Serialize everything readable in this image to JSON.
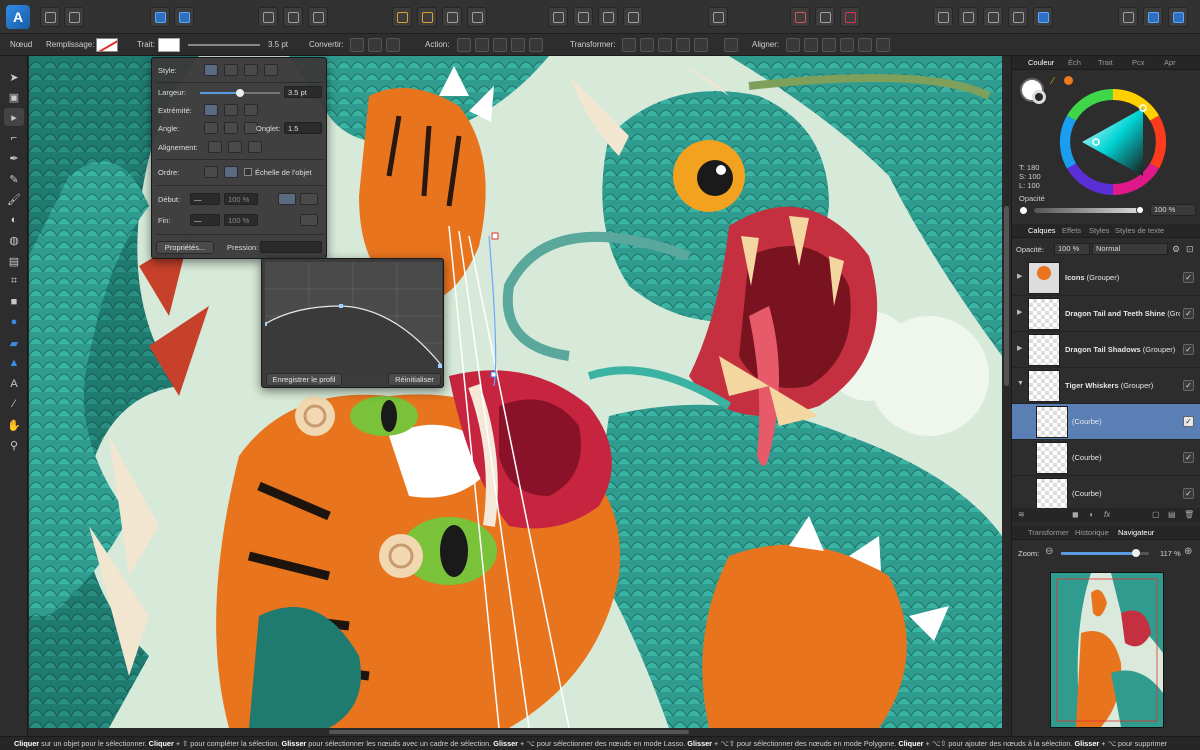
{
  "context_bar": {
    "mode": "Nœud",
    "fill_label": "Remplissage:",
    "stroke_label": "Trait:",
    "stroke_width": "3.5 pt",
    "convert_label": "Convertir:",
    "action_label": "Action:",
    "transform_label": "Transformer:",
    "align_label": "Aligner:"
  },
  "stroke_popover": {
    "style_label": "Style:",
    "width_label": "Largeur:",
    "width_value": "3.5 pt",
    "width_fraction": 0.5,
    "cap_label": "Extrémité:",
    "join_label": "Angle:",
    "miter_label": "Onglet:",
    "miter_value": "1.5",
    "align_label": "Alignement:",
    "order_label": "Ordre:",
    "scale_label": "Échelle de l'objet",
    "start_label": "Début:",
    "end_label": "Fin:",
    "start_pct": "100 %",
    "start_pct2": "100 %",
    "end_pct": "100 %",
    "end_pct2": "100 %",
    "properties_button": "Propriétés...",
    "pressure_label": "Pression:"
  },
  "pressure_popover": {
    "save_profile": "Enregistrer le profil",
    "reset": "Réinitialiser"
  },
  "color_panel": {
    "tabs": [
      "Couleur",
      "Éch",
      "Trait",
      "Pcx",
      "Apr"
    ],
    "active_tab": "Couleur",
    "t_value": "T: 180",
    "s_value": "S: 100",
    "l_value": "L: 100",
    "opacity_label": "Opacité",
    "opacity_value": "100 %"
  },
  "layers_panel": {
    "tabs": [
      "Calques",
      "Effets",
      "Styles",
      "Styles de texte"
    ],
    "active_tab": "Calques",
    "opacity_label": "Opacité:",
    "opacity_value": "100 %",
    "blend_mode": "Normal",
    "layers": [
      {
        "name": "Icons",
        "suffix": " (Grouper)"
      },
      {
        "name": "Dragon Tail and Teeth Shine",
        "suffix": " (Grouper)"
      },
      {
        "name": "Dragon Tail Shadows",
        "suffix": " (Grouper)"
      },
      {
        "name": "Tiger Whiskers",
        "suffix": " (Grouper)"
      },
      {
        "name": "(Courbe)",
        "suffix": ""
      },
      {
        "name": "(Courbe)",
        "suffix": ""
      },
      {
        "name": "(Courbe)",
        "suffix": ""
      }
    ]
  },
  "navigator_panel": {
    "tabs": [
      "Transformer",
      "Historique",
      "Navigateur"
    ],
    "active_tab": "Navigateur",
    "zoom_label": "Zoom:",
    "zoom_value": "117 %",
    "zoom_fraction": 0.85
  },
  "status": {
    "s1": "Cliquer",
    "s2": " sur un objet pour le sélectionner. ",
    "s3": "Cliquer",
    "s4": " + ⇧ pour compléter la sélection. ",
    "s5": "Glisser",
    "s6": " pour sélectionner les nœuds avec un cadre de sélection. ",
    "s7": "Glisser",
    "s8": " + ⌥ pour sélectionner des nœuds en mode Lasso. ",
    "s9": "Glisser",
    "s10": " + ⌥⇧ pour sélectionner des nœuds en mode Polygone. ",
    "s11": "Cliquer",
    "s12": " + ⌥⇧ pour ajouter des nœuds à la sélection. ",
    "s13": "Glisser",
    "s14": " + ⌥ pour supprimer"
  },
  "colors": {
    "accent": "#5a7fb5",
    "dragon_teal": "#2f9c8f",
    "tiger_orange": "#e8741e"
  }
}
